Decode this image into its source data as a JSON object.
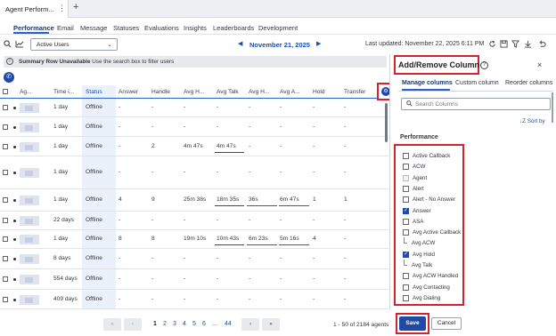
{
  "window": {
    "page_tab": "Agent Perform...",
    "more_glyph": "⋮",
    "add_tab_glyph": "+"
  },
  "nav": {
    "tabs": [
      "Performance",
      "Email",
      "Message",
      "Statuses",
      "Evaluations",
      "Insights",
      "Leaderboards",
      "Development"
    ],
    "active": "Performance"
  },
  "toolbar": {
    "filter_value": "Active Users",
    "date": "November 21, 2025",
    "last_updated": "Last updated: November 22, 2025 6:11 PM",
    "icons": [
      "search-icon",
      "chart-icon",
      "refresh-icon",
      "calendar-icon",
      "save-icon",
      "filter-icon",
      "download-icon",
      "undo-icon"
    ]
  },
  "info_bar": {
    "bold": "Summary Row Unavailable",
    "text": "Use the search box to filter users"
  },
  "grid": {
    "headers": [
      "Ag...",
      "Time i...",
      "Status",
      "Answer",
      "Handle",
      "Avg H...",
      "Avg Talk",
      "Avg H...",
      "Avg A...",
      "Hold",
      "Transfer"
    ],
    "rows": [
      {
        "time": "1 day",
        "status": "Offline",
        "answer": "-",
        "handle": "-",
        "avg_handle": "-",
        "avg_talk": "-",
        "avg_hold": "-",
        "avg_acw": "-",
        "hold": "-",
        "transfer": "-"
      },
      {
        "time": "1 day",
        "status": "Offline",
        "answer": "-",
        "handle": "-",
        "avg_handle": "-",
        "avg_talk": "-",
        "avg_hold": "-",
        "avg_acw": "-",
        "hold": "-",
        "transfer": "-"
      },
      {
        "time": "1 day",
        "status": "Offline",
        "answer": "-",
        "handle": "2",
        "avg_handle": "4m 47s",
        "avg_talk": "4m 47s",
        "avg_hold": "-",
        "avg_acw": "-",
        "hold": "-",
        "transfer": "-"
      },
      {
        "time": "1 day",
        "status": "Offline",
        "answer": "-",
        "handle": "-",
        "avg_handle": "-",
        "avg_talk": "-",
        "avg_hold": "-",
        "avg_acw": "-",
        "hold": "-",
        "transfer": "-"
      },
      {
        "time": "1 day",
        "status": "Offline",
        "answer": "4",
        "handle": "9",
        "avg_handle": "25m 38s",
        "avg_talk": "18m 35s",
        "avg_hold": "36s",
        "avg_acw": "6m 47s",
        "hold": "1",
        "transfer": "1"
      },
      {
        "time": "22 days",
        "status": "Offline",
        "answer": "-",
        "handle": "-",
        "avg_handle": "-",
        "avg_talk": "-",
        "avg_hold": "-",
        "avg_acw": "-",
        "hold": "-",
        "transfer": "-"
      },
      {
        "time": "1 day",
        "status": "Offline",
        "answer": "8",
        "handle": "8",
        "avg_handle": "19m 10s",
        "avg_talk": "10m 43s",
        "avg_hold": "6m 23s",
        "avg_acw": "5m 16s",
        "hold": "4",
        "transfer": "-"
      },
      {
        "time": "8 days",
        "status": "Offline",
        "answer": "-",
        "handle": "-",
        "avg_handle": "-",
        "avg_talk": "-",
        "avg_hold": "-",
        "avg_acw": "-",
        "hold": "-",
        "transfer": "-"
      },
      {
        "time": "554 days",
        "status": "Offline",
        "answer": "-",
        "handle": "-",
        "avg_handle": "-",
        "avg_talk": "-",
        "avg_hold": "-",
        "avg_acw": "-",
        "hold": "-",
        "transfer": "-"
      },
      {
        "time": "409 days",
        "status": "Offline",
        "answer": "-",
        "handle": "-",
        "avg_handle": "-",
        "avg_talk": "-",
        "avg_hold": "-",
        "avg_acw": "-",
        "hold": "-",
        "transfer": "-"
      }
    ]
  },
  "pager": {
    "first": "«",
    "prev": "‹",
    "next": "›",
    "last": "»",
    "pages": [
      "1",
      "2",
      "3",
      "4",
      "5",
      "6",
      "...",
      "44"
    ],
    "current": "1",
    "summary": "1 - 50 of 2184 agents"
  },
  "panel": {
    "title": "Add/Remove Column",
    "help_glyph": "?",
    "close_glyph": "×",
    "tabs": [
      "Manage columns",
      "Custom column",
      "Reorder columns"
    ],
    "search_placeholder": "Search Columns",
    "sort_by": "↓Z Sort by",
    "section": "Performance",
    "columns": [
      {
        "label": "Active Callback",
        "state": "off"
      },
      {
        "label": "ACW",
        "state": "off"
      },
      {
        "label": "Agent",
        "state": "disabled"
      },
      {
        "label": "Alert",
        "state": "off"
      },
      {
        "label": "Alert - No Answer",
        "state": "off"
      },
      {
        "label": "Answer",
        "state": "on"
      },
      {
        "label": "ASA",
        "state": "off"
      },
      {
        "label": "Avg Active Callback",
        "state": "off"
      },
      {
        "label": "Avg ACW",
        "state": "sub"
      },
      {
        "label": "Avg Hold",
        "state": "on"
      },
      {
        "label": "Avg Talk",
        "state": "sub"
      },
      {
        "label": "Avg ACW Handled",
        "state": "off"
      },
      {
        "label": "Avg Contacting",
        "state": "off"
      },
      {
        "label": "Avg Dialing",
        "state": "off"
      }
    ],
    "save": "Save",
    "cancel": "Cancel"
  }
}
